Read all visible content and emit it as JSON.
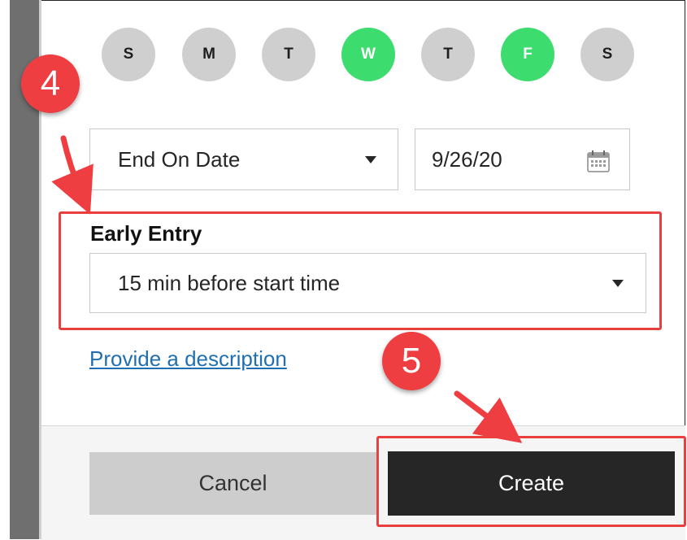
{
  "weekdays": [
    {
      "letter": "S",
      "selected": false
    },
    {
      "letter": "M",
      "selected": false
    },
    {
      "letter": "T",
      "selected": false
    },
    {
      "letter": "W",
      "selected": true
    },
    {
      "letter": "T",
      "selected": false
    },
    {
      "letter": "F",
      "selected": true
    },
    {
      "letter": "S",
      "selected": false
    }
  ],
  "recurrence": {
    "end_type": "End On Date",
    "end_date": "9/26/20"
  },
  "early_entry": {
    "label": "Early Entry",
    "value": "15 min before start time"
  },
  "description_link": "Provide a description",
  "footer": {
    "cancel_label": "Cancel",
    "create_label": "Create"
  },
  "annotations": {
    "step4": "4",
    "step5": "5"
  },
  "colors": {
    "selected_day": "#3ddc6f",
    "unselected_day": "#cfcfcf",
    "highlight": "#e8403f",
    "link": "#1f6fb2",
    "create_button": "#262626"
  },
  "icons": [
    "calendar-icon",
    "chevron-down-icon",
    "arrow-icon"
  ]
}
